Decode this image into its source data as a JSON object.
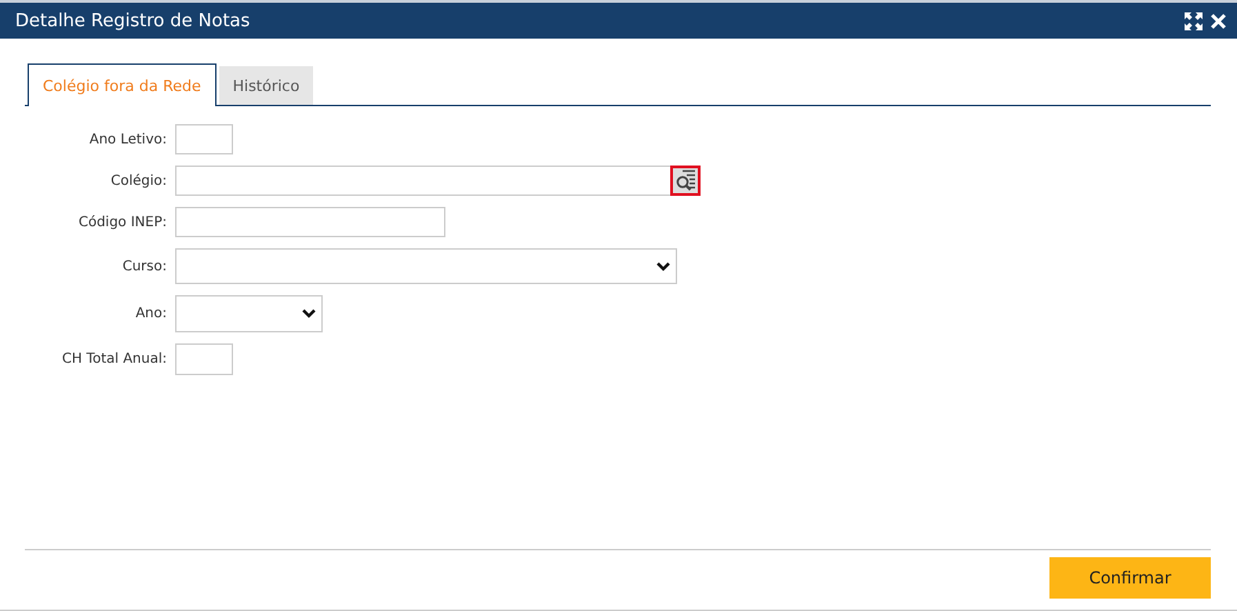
{
  "window": {
    "title": "Detalhe Registro de Notas"
  },
  "tabs": [
    {
      "label": "Colégio fora da Rede",
      "selected": true
    },
    {
      "label": "Histórico",
      "selected": false
    }
  ],
  "fields": [
    {
      "label": "Ano Letivo:",
      "kind": "text"
    },
    {
      "label": "Colégio:",
      "kind": "lookup"
    },
    {
      "label": "Código INEP:",
      "kind": "text"
    },
    {
      "label": "Curso:",
      "kind": "select"
    },
    {
      "label": "Ano:",
      "kind": "select"
    },
    {
      "label": "CH Total Anual:",
      "kind": "text"
    }
  ],
  "buttons": [
    "Confirmar"
  ]
}
